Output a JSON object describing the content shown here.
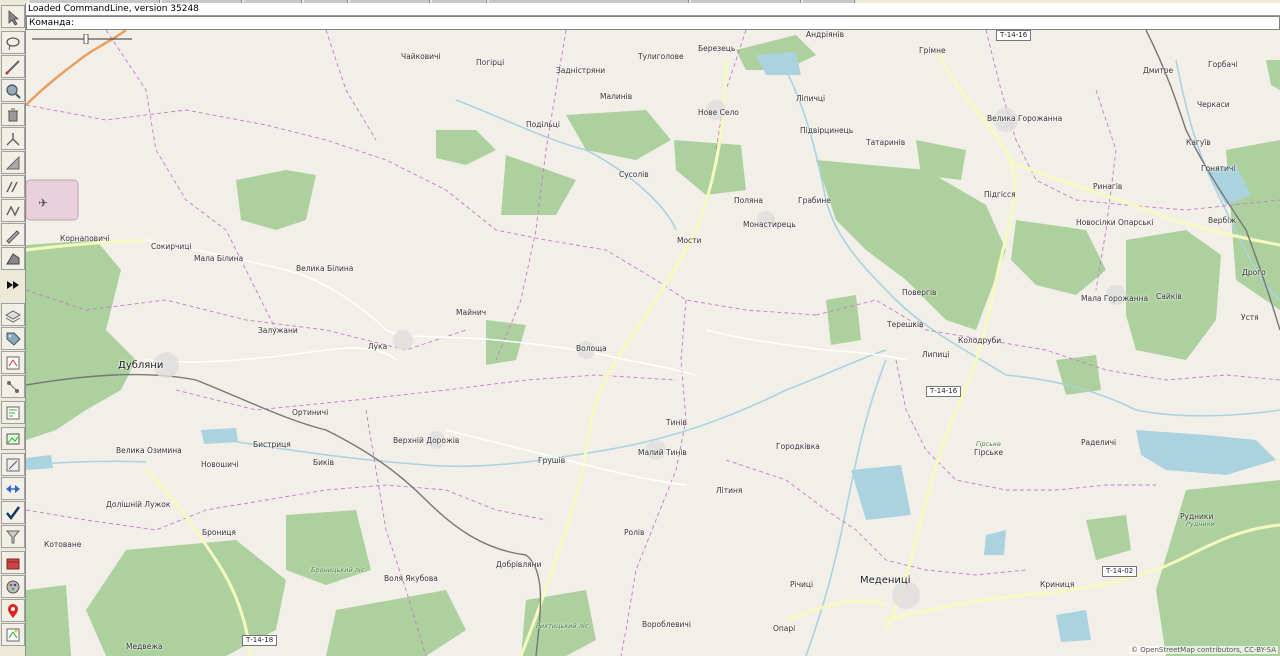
{
  "command_log": "Loaded CommandLine, version 35248",
  "command_prompt": "Команда:",
  "attribution": "© OpenStreetMap contributors, CC-BY-SA",
  "colors": {
    "map_bg": "#f2efe9",
    "forest": "#add19e",
    "water": "#aad3df",
    "road": "#f7fabf",
    "boundary": "#c77bc7",
    "railway": "#777777"
  },
  "tools": [
    {
      "icon": "select-icon"
    },
    {
      "icon": "lasso-icon"
    },
    {
      "icon": "draw-line-icon"
    },
    {
      "icon": "zoom-icon"
    },
    {
      "icon": "delete-icon"
    },
    {
      "icon": "split-icon"
    },
    {
      "icon": "align-icon"
    },
    {
      "icon": "parallel-icon"
    },
    {
      "icon": "simplify-icon"
    },
    {
      "icon": "pencil-icon"
    },
    {
      "icon": "building-icon"
    },
    {
      "icon": "more-icon"
    },
    {
      "icon": "layers-icon"
    },
    {
      "icon": "tag-icon"
    },
    {
      "icon": "preset-icon"
    },
    {
      "icon": "relation-icon"
    },
    {
      "icon": "filter-icon"
    },
    {
      "icon": "image-icon"
    },
    {
      "icon": "measure-icon"
    },
    {
      "icon": "merge-icon"
    },
    {
      "icon": "validate-icon"
    },
    {
      "icon": "funnel-icon"
    },
    {
      "icon": "package-icon"
    },
    {
      "icon": "palette-icon"
    },
    {
      "icon": "marker-icon"
    },
    {
      "icon": "plugin-icon"
    }
  ],
  "places": [
    {
      "name": "Чайковичі"
    },
    {
      "name": "Погірці"
    },
    {
      "name": "Задністряни"
    },
    {
      "name": "Тулиголове"
    },
    {
      "name": "Березець"
    },
    {
      "name": "Андріянів"
    },
    {
      "name": "Грімне"
    },
    {
      "name": "Дмитре"
    },
    {
      "name": "Горбачі"
    },
    {
      "name": "Малинів"
    },
    {
      "name": "Нове Село"
    },
    {
      "name": "Ліпичці"
    },
    {
      "name": "Підвірцинець"
    },
    {
      "name": "Велика Горожанна"
    },
    {
      "name": "Черкаси"
    },
    {
      "name": "Подільці"
    },
    {
      "name": "Татаринів"
    },
    {
      "name": "Кагуїв"
    },
    {
      "name": "Сусолів"
    },
    {
      "name": "Гонятичі"
    },
    {
      "name": "Поляна"
    },
    {
      "name": "Грабине"
    },
    {
      "name": "Підгісся"
    },
    {
      "name": "Ринагів"
    },
    {
      "name": "Вербіж"
    },
    {
      "name": "Корнаповичі"
    },
    {
      "name": "Сокирчиці"
    },
    {
      "name": "Монастирець"
    },
    {
      "name": "Мости"
    },
    {
      "name": "Новосілки Опарські"
    },
    {
      "name": "Мала Білина"
    },
    {
      "name": "Велика Білина"
    },
    {
      "name": "Дрого"
    },
    {
      "name": "Повергів"
    },
    {
      "name": "Мала Горожанна"
    },
    {
      "name": "Сайків"
    },
    {
      "name": "Майнич"
    },
    {
      "name": "Терешків"
    },
    {
      "name": "Устя"
    },
    {
      "name": "Залужани"
    },
    {
      "name": "Лука"
    },
    {
      "name": "Волоща"
    },
    {
      "name": "Липиці"
    },
    {
      "name": "Колодруби"
    },
    {
      "name": "Дубляни"
    },
    {
      "name": "Ортиничі"
    },
    {
      "name": "Тинів"
    },
    {
      "name": "Верхній Дорожів"
    },
    {
      "name": "Бистриця"
    },
    {
      "name": "Городківка"
    },
    {
      "name": "Раделичі"
    },
    {
      "name": "Велика Озимина"
    },
    {
      "name": "Малий Тинів"
    },
    {
      "name": "Гірське"
    },
    {
      "name": "Новошичі"
    },
    {
      "name": "Биків"
    },
    {
      "name": "Грушів"
    },
    {
      "name": "Долішній Лужок"
    },
    {
      "name": "Літиня"
    },
    {
      "name": "Рудники"
    },
    {
      "name": "Котоване"
    },
    {
      "name": "Брониця"
    },
    {
      "name": "Ролів"
    },
    {
      "name": "Воля Якубова"
    },
    {
      "name": "Добрівляни"
    },
    {
      "name": "Річиці"
    },
    {
      "name": "Медениці"
    },
    {
      "name": "Криниця"
    },
    {
      "name": "Вороблевичі"
    },
    {
      "name": "Опарі"
    },
    {
      "name": "Медвежа"
    }
  ],
  "forests": [
    {
      "name": "Броницький ліс"
    },
    {
      "name": "Рихтицький ліс"
    },
    {
      "name": "Гірське"
    },
    {
      "name": "Рудники"
    }
  ],
  "roads": [
    {
      "ref": "Т-14-16"
    },
    {
      "ref": "Т-14-16"
    },
    {
      "ref": "Т-14-02"
    },
    {
      "ref": "Т-14-18"
    }
  ]
}
